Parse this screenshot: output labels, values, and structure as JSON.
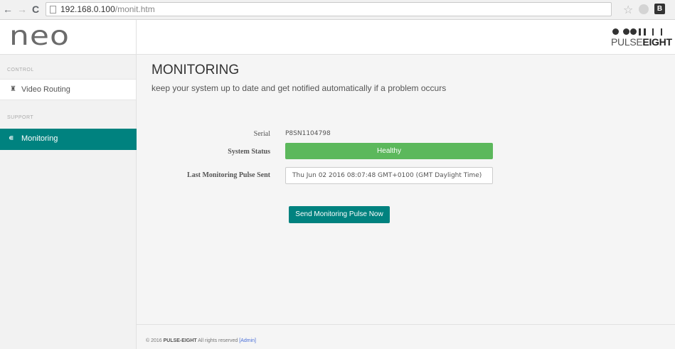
{
  "browser": {
    "url_host": "192.168.0.100",
    "url_path": "/monit.htm",
    "back_icon": "back-arrow-icon",
    "forward_icon": "forward-arrow-icon",
    "reload_icon": "reload-icon"
  },
  "header": {
    "logo": "neo",
    "brand_light": "PULSE",
    "brand_bold": "EIGHT"
  },
  "sidebar": {
    "section_control": "CONTROL",
    "section_support": "SUPPORT",
    "items": [
      {
        "label": "Video Routing",
        "icon": "home-icon",
        "active": false
      },
      {
        "label": "Monitoring",
        "icon": "rss-icon",
        "active": true
      }
    ]
  },
  "main": {
    "title": "MONITORING",
    "subtitle": "keep your system up to date and get notified automatically if a problem occurs",
    "form": {
      "serial_label": "Serial",
      "serial_value": "P8SN1104798",
      "status_label": "System Status",
      "status_value": "Healthy",
      "pulse_label": "Last Monitoring Pulse Sent",
      "pulse_value": "Thu Jun 02 2016 08:07:48 GMT+0100 (GMT Daylight Time)"
    },
    "send_button": "Send Monitoring Pulse Now"
  },
  "footer": {
    "copyright_prefix": "© 2016",
    "company": "PULSE-EIGHT",
    "rights": "All rights reserved",
    "admin_link": "[Admin]"
  },
  "colors": {
    "accent": "#00827f",
    "success": "#5cb85c",
    "sidebar_bg": "#f2f2f2",
    "content_bg": "#f5f5f5"
  }
}
